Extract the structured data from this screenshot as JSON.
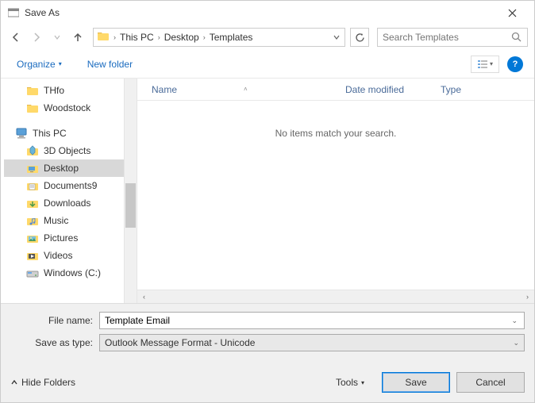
{
  "title": "Save As",
  "breadcrumb": [
    "This PC",
    "Desktop",
    "Templates"
  ],
  "search": {
    "placeholder": "Search Templates"
  },
  "toolbar": {
    "organize": "Organize",
    "newfolder": "New folder"
  },
  "tree": [
    {
      "label": "THfo",
      "icon": "folder",
      "level": 2
    },
    {
      "label": "Woodstock",
      "icon": "folder",
      "level": 2
    },
    {
      "label": "",
      "icon": "none",
      "level": 0,
      "spacer": true
    },
    {
      "label": "This PC",
      "icon": "pc",
      "level": 1
    },
    {
      "label": "3D Objects",
      "icon": "3d",
      "level": 2
    },
    {
      "label": "Desktop",
      "icon": "desktop",
      "level": 2,
      "selected": true
    },
    {
      "label": "Documents9",
      "icon": "docs",
      "level": 2
    },
    {
      "label": "Downloads",
      "icon": "downloads",
      "level": 2
    },
    {
      "label": "Music",
      "icon": "music",
      "level": 2
    },
    {
      "label": "Pictures",
      "icon": "pictures",
      "level": 2
    },
    {
      "label": "Videos",
      "icon": "videos",
      "level": 2
    },
    {
      "label": "Windows (C:)",
      "icon": "drive",
      "level": 2
    }
  ],
  "columns": {
    "name": "Name",
    "date": "Date modified",
    "type": "Type"
  },
  "empty_message": "No items match your search.",
  "filename": {
    "label": "File name:",
    "value": "Template Email"
  },
  "filetype": {
    "label": "Save as type:",
    "value": "Outlook Message Format - Unicode"
  },
  "hide_folders": "Hide Folders",
  "tools": "Tools",
  "save": "Save",
  "cancel": "Cancel"
}
